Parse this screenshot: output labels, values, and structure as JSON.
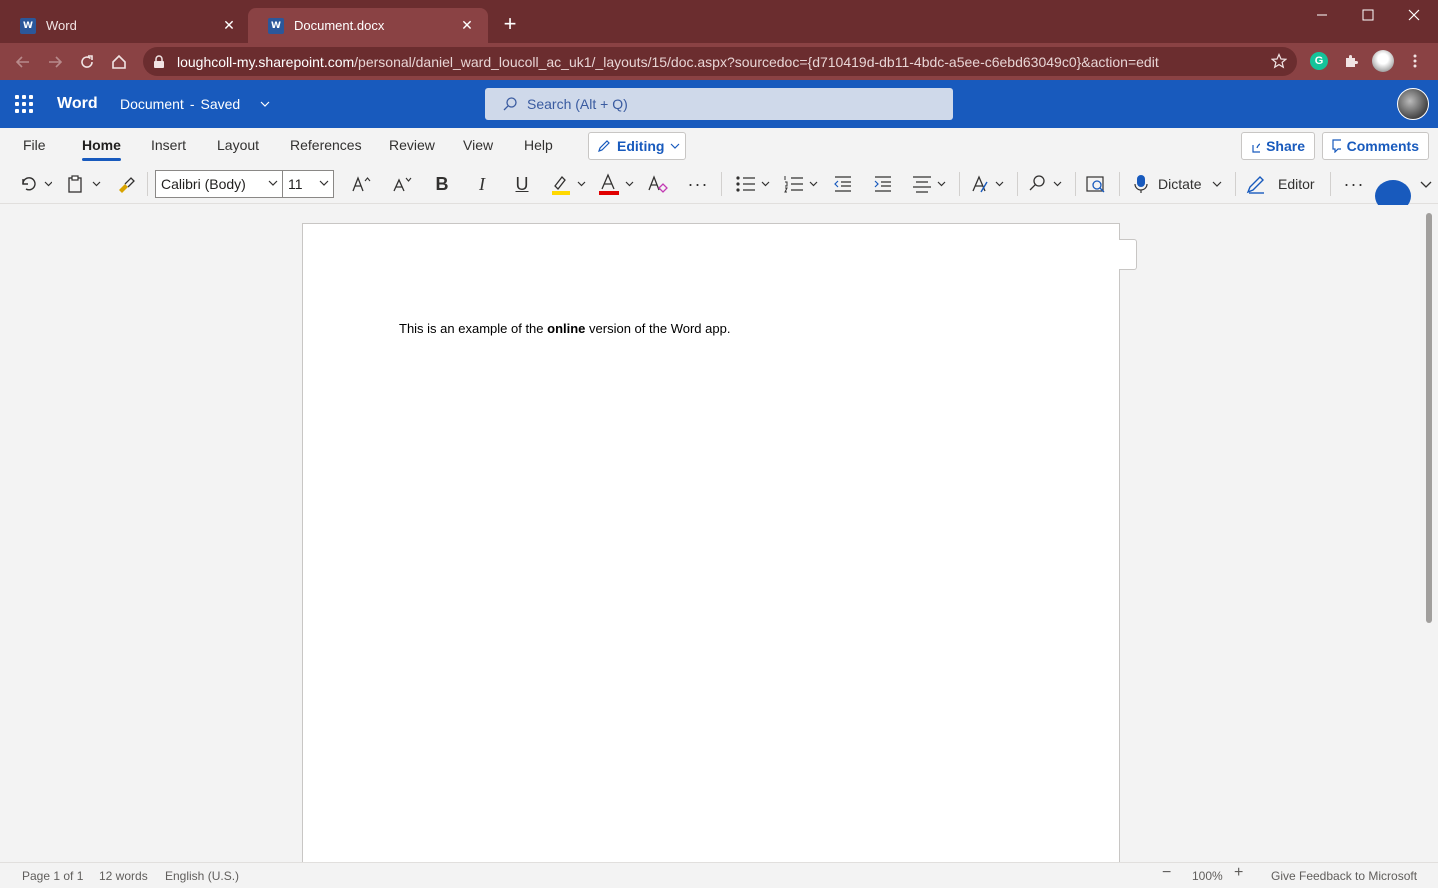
{
  "browser": {
    "tabs": [
      {
        "title": "Word",
        "active": false
      },
      {
        "title": "Document.docx",
        "active": true
      }
    ],
    "tab_badge": "W",
    "url_domain": "loughcoll-my.sharepoint.com",
    "url_path": "/personal/daniel_ward_loucoll_ac_uk1/_layouts/15/doc.aspx?sourcedoc={d710419d-db11-4bdc-a5ee-c6ebd63049c0}&action=edit",
    "extension_badge": "G"
  },
  "office": {
    "app_name": "Word",
    "doc_name": "Document",
    "doc_sep": "-",
    "doc_status": "Saved",
    "search_placeholder": "Search (Alt + Q)"
  },
  "ribbon": {
    "tabs": [
      "File",
      "Home",
      "Insert",
      "Layout",
      "References",
      "Review",
      "View",
      "Help"
    ],
    "selected_tab": "Home",
    "editing_label": "Editing",
    "share_label": "Share",
    "comments_label": "Comments"
  },
  "toolbar": {
    "font_name": "Calibri (Body)",
    "font_size": "11",
    "bold": "B",
    "italic": "I",
    "underline": "U",
    "font_color_letter": "A",
    "dictate_label": "Dictate",
    "editor_label": "Editor",
    "more": "···"
  },
  "document": {
    "text_before": "This is an example of the ",
    "text_bold": "online",
    "text_after": " version of the Word app."
  },
  "status": {
    "page": "Page 1 of 1",
    "words": "12 words",
    "language": "English (U.S.)",
    "zoom": "100%",
    "feedback": "Give Feedback to Microsoft"
  },
  "colors": {
    "tabbar": "#6b2d2f",
    "office_blue": "#185abd",
    "highlight": "#ffd800",
    "font_color": "#e00000"
  }
}
